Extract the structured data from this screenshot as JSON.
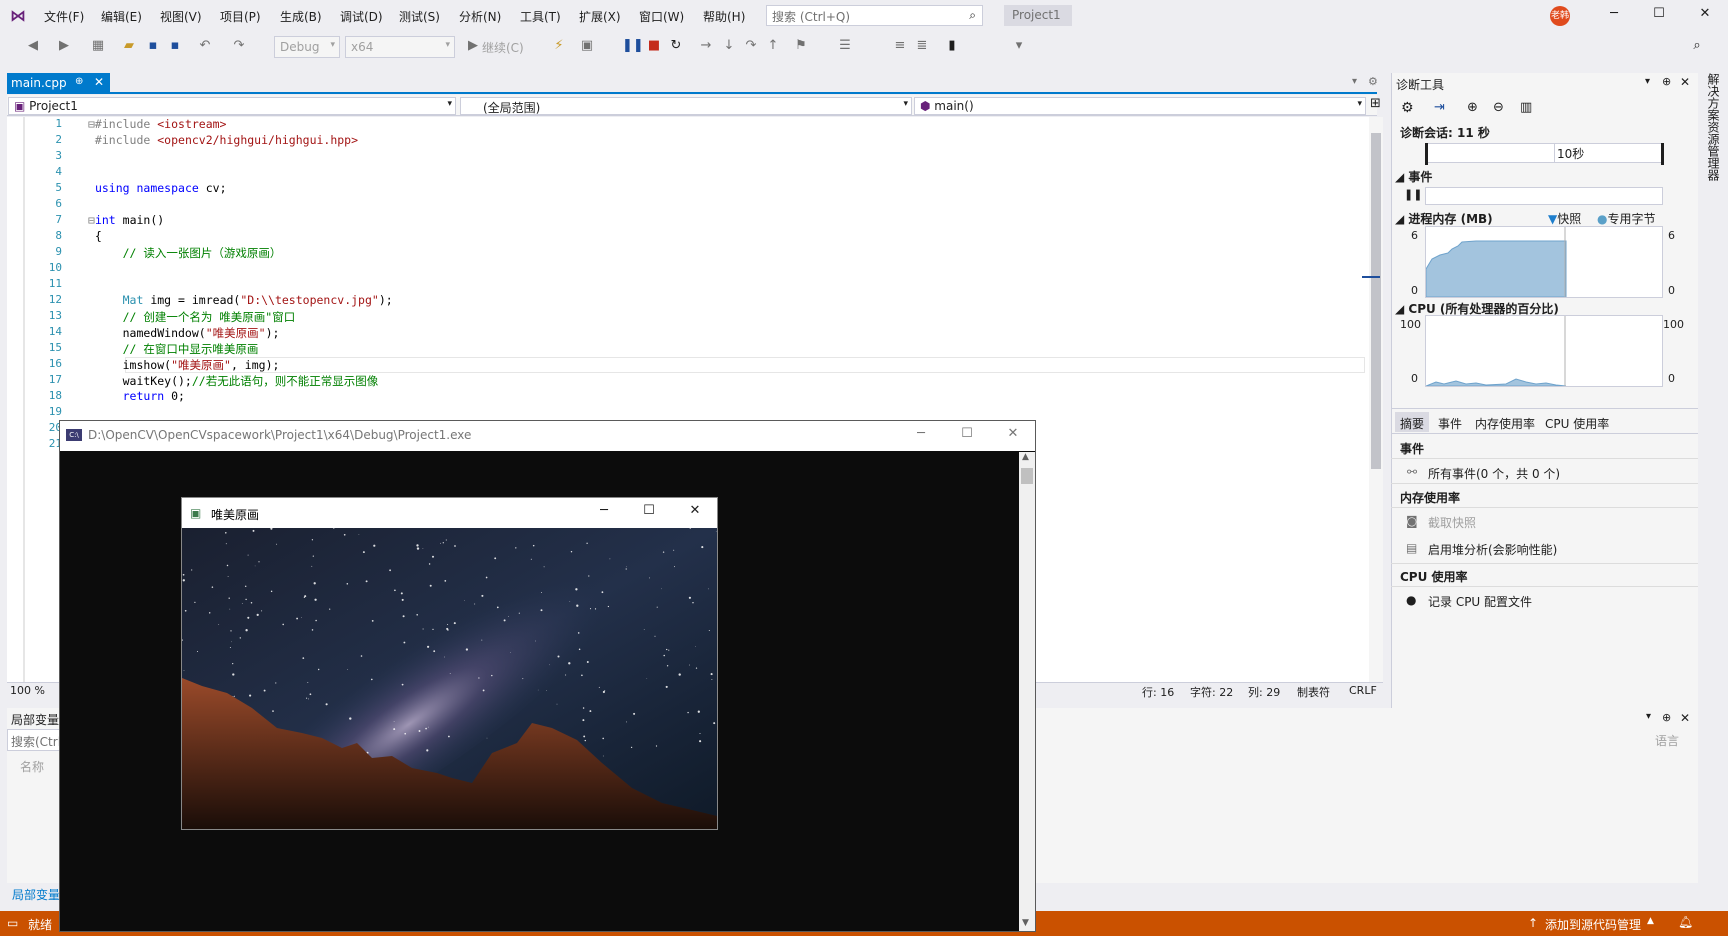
{
  "menu": [
    "文件(F)",
    "编辑(E)",
    "视图(V)",
    "项目(P)",
    "生成(B)",
    "调试(D)",
    "测试(S)",
    "分析(N)",
    "工具(T)",
    "扩展(X)",
    "窗口(W)",
    "帮助(H)"
  ],
  "search": {
    "placeholder": "搜索 (Ctrl+Q)"
  },
  "project_badge": "Project1",
  "avatar_text": "老韩",
  "toolbar": {
    "config": "Debug",
    "platform": "x64",
    "continue": "继续(C)"
  },
  "doc_tab": {
    "label": "main.cpp"
  },
  "nav": {
    "project": "Project1",
    "scope": "(全局范围)",
    "member": "main()"
  },
  "line_numbers": [
    "1",
    "2",
    "3",
    "4",
    "5",
    "6",
    "7",
    "8",
    "9",
    "10",
    "11",
    "12",
    "13",
    "14",
    "15",
    "16",
    "17",
    "18",
    "19",
    "20",
    "21"
  ],
  "status_row": {
    "zoom": "100 %",
    "line": "行: 16",
    "char": "字符: 22",
    "col": "列: 29",
    "tab": "制表符",
    "eol": "CRLF"
  },
  "diag": {
    "title": "诊断工具",
    "session": "诊断会话: 11 秒",
    "timeline_label": "10秒",
    "events_header": "事件",
    "memory_header": "进程内存 (MB)",
    "snapshot_legend": "快照",
    "private_bytes_legend": "专用字节",
    "mem_max": "6",
    "mem_min": "0",
    "cpu_header": "CPU (所有处理器的百分比)",
    "cpu_max": "100",
    "cpu_min": "0",
    "tabs": [
      "摘要",
      "事件",
      "内存使用率",
      "CPU 使用率"
    ],
    "section_events": "事件",
    "all_events": "所有事件(0 个，共 0 个)",
    "section_memory": "内存使用率",
    "take_snapshot": "截取快照",
    "heap_analysis": "启用堆分析(会影响性能)",
    "section_cpu": "CPU 使用率",
    "record_cpu": "记录 CPU 配置文件"
  },
  "side_tab": "解决方案资源管理器",
  "bottom": {
    "locals_title": "局部变量",
    "search_placeholder": "搜索(Ctrl",
    "name_col": "名称",
    "lang_col": "语言",
    "bottom_tab": "局部变量"
  },
  "statusbar": {
    "ready": "就绪",
    "source_control": "添加到源代码管理"
  },
  "console": {
    "title": "D:\\OpenCV\\OpenCVspacework\\Project1\\x64\\Debug\\Project1.exe"
  },
  "cv_window": {
    "title": "唯美原画"
  },
  "colors": {
    "accent": "#007acc",
    "statusbar": "#ca5100",
    "console_bg": "#0c0c0c"
  }
}
